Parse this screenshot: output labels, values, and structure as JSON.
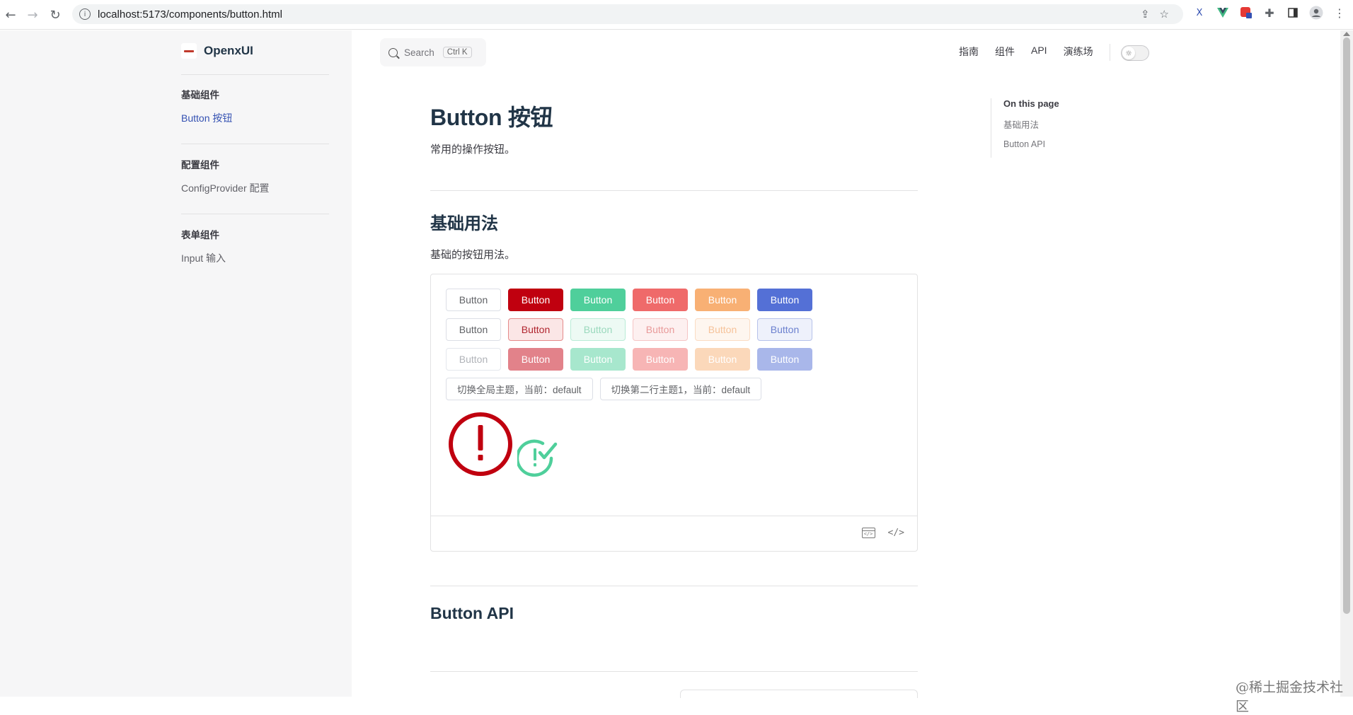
{
  "browser": {
    "url": "localhost:5173/components/button.html",
    "back_icon": "←",
    "forward_icon": "→",
    "reload_icon": "↻",
    "info_icon": "i",
    "share_icon": "⇪",
    "star_icon": "☆"
  },
  "sidebar": {
    "brand": "OpenxUI",
    "groups": [
      {
        "title": "基础组件",
        "items": [
          {
            "label": "Button 按钮",
            "active": true
          }
        ]
      },
      {
        "title": "配置组件",
        "items": [
          {
            "label": "ConfigProvider 配置",
            "active": false
          }
        ]
      },
      {
        "title": "表单组件",
        "items": [
          {
            "label": "Input 输入",
            "active": false
          }
        ]
      }
    ]
  },
  "topbar": {
    "search_label": "Search",
    "search_kbd": "Ctrl K",
    "nav": [
      "指南",
      "组件",
      "API",
      "演练场"
    ]
  },
  "content": {
    "title": "Button 按钮",
    "lead": "常用的操作按钮。",
    "section1_title": "基础用法",
    "section1_desc": "基础的按钮用法。",
    "button_label": "Button",
    "toggle_global": "切换全局主题，当前：default",
    "toggle_row2": "切换第二行主题1，当前：default",
    "section2_title": "Button API"
  },
  "aside": {
    "title": "On this page",
    "links": [
      "基础用法",
      "Button API"
    ]
  },
  "colors": {
    "danger_red": "#c0000f",
    "success_green": "#4fcf9b",
    "light_red": "#ef6a6a",
    "orange": "#f8b074",
    "blue": "#5470d6",
    "link_blue": "#3451b2"
  },
  "watermark": "@稀土掘金技术社区"
}
